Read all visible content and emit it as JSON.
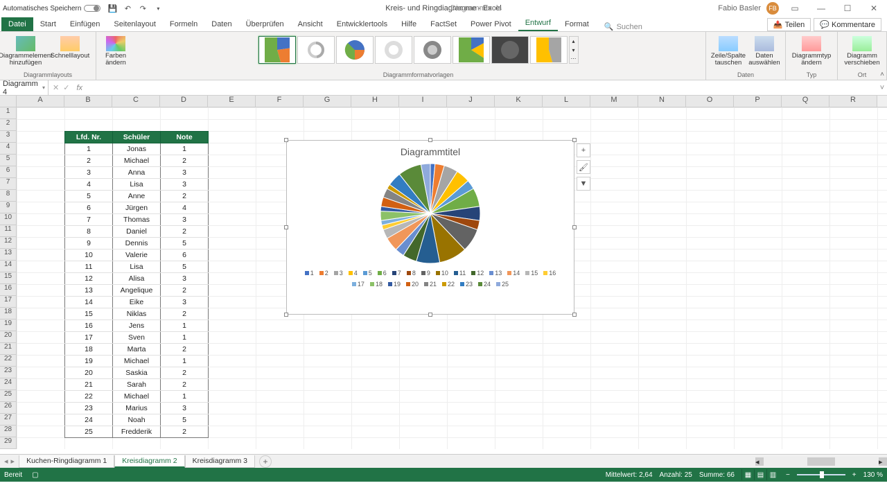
{
  "title_bar": {
    "autosave_label": "Automatisches Speichern",
    "doc_title": "Kreis- und Ringdiagramme  -  Excel",
    "tools_context": "Diagrammtools",
    "user_name": "Fabio Basler",
    "user_initials": "FB"
  },
  "tabs": {
    "file": "Datei",
    "list": [
      "Start",
      "Einfügen",
      "Seitenlayout",
      "Formeln",
      "Daten",
      "Überprüfen",
      "Ansicht",
      "Entwicklertools",
      "Hilfe",
      "FactSet",
      "Power Pivot"
    ],
    "ctx_entwurf": "Entwurf",
    "ctx_format": "Format",
    "tell_me": "Suchen",
    "share": "Teilen",
    "comments": "Kommentare"
  },
  "ribbon": {
    "add_element": "Diagrammelement hinzufügen",
    "quick_layout": "Schnelllayout",
    "change_colors": "Farben ändern",
    "group_layouts": "Diagrammlayouts",
    "group_styles": "Diagrammformatvorlagen",
    "switch_rc": "Zeile/Spalte tauschen",
    "select_data": "Daten auswählen",
    "group_data": "Daten",
    "change_type": "Diagrammtyp ändern",
    "group_type": "Typ",
    "move_chart": "Diagramm verschieben",
    "group_loc": "Ort"
  },
  "namebox": {
    "value": "Diagramm 4"
  },
  "columns": [
    "A",
    "B",
    "C",
    "D",
    "E",
    "F",
    "G",
    "H",
    "I",
    "J",
    "K",
    "L",
    "M",
    "N",
    "O",
    "P",
    "Q",
    "R"
  ],
  "row_count": 29,
  "headers": {
    "b": "Lfd. Nr.",
    "c": "Schüler",
    "d": "Note"
  },
  "rows": [
    {
      "n": 1,
      "s": "Jonas",
      "g": 1
    },
    {
      "n": 2,
      "s": "Michael",
      "g": 2
    },
    {
      "n": 3,
      "s": "Anna",
      "g": 3
    },
    {
      "n": 4,
      "s": "Lisa",
      "g": 3
    },
    {
      "n": 5,
      "s": "Anne",
      "g": 2
    },
    {
      "n": 6,
      "s": "Jürgen",
      "g": 4
    },
    {
      "n": 7,
      "s": "Thomas",
      "g": 3
    },
    {
      "n": 8,
      "s": "Daniel",
      "g": 2
    },
    {
      "n": 9,
      "s": "Dennis",
      "g": 5
    },
    {
      "n": 10,
      "s": "Valerie",
      "g": 6
    },
    {
      "n": 11,
      "s": "Lisa",
      "g": 5
    },
    {
      "n": 12,
      "s": "Alisa",
      "g": 3
    },
    {
      "n": 13,
      "s": "Angelique",
      "g": 2
    },
    {
      "n": 14,
      "s": "Eike",
      "g": 3
    },
    {
      "n": 15,
      "s": "Niklas",
      "g": 2
    },
    {
      "n": 16,
      "s": "Jens",
      "g": 1
    },
    {
      "n": 17,
      "s": "Sven",
      "g": 1
    },
    {
      "n": 18,
      "s": "Marta",
      "g": 2
    },
    {
      "n": 19,
      "s": "Michael",
      "g": 1
    },
    {
      "n": 20,
      "s": "Saskia",
      "g": 2
    },
    {
      "n": 21,
      "s": "Sarah",
      "g": 2
    },
    {
      "n": 22,
      "s": "Michael",
      "g": 1
    },
    {
      "n": 23,
      "s": "Marius",
      "g": 3
    },
    {
      "n": 24,
      "s": "Noah",
      "g": 5
    },
    {
      "n": 25,
      "s": "Fredderik",
      "g": 2
    }
  ],
  "chart": {
    "title": "Diagrammtitel",
    "legend": [
      "1",
      "2",
      "3",
      "4",
      "5",
      "6",
      "7",
      "8",
      "9",
      "10",
      "11",
      "12",
      "13",
      "14",
      "15",
      "16",
      "17",
      "18",
      "19",
      "20",
      "21",
      "22",
      "23",
      "24",
      "25"
    ],
    "colors": [
      "#4472c4",
      "#ed7d31",
      "#a5a5a5",
      "#ffc000",
      "#5b9bd5",
      "#70ad47",
      "#264478",
      "#9e480e",
      "#636363",
      "#997300",
      "#255e91",
      "#43682b",
      "#698ed0",
      "#f1975a",
      "#b7b7b7",
      "#ffcd33",
      "#7cafdd",
      "#8cc168",
      "#335aa1",
      "#d26012",
      "#848484",
      "#cc9a00",
      "#327dc2",
      "#5a8a39",
      "#8faadc"
    ]
  },
  "chart_data": {
    "type": "pie",
    "title": "Diagrammtitel",
    "categories": [
      "1",
      "2",
      "3",
      "4",
      "5",
      "6",
      "7",
      "8",
      "9",
      "10",
      "11",
      "12",
      "13",
      "14",
      "15",
      "16",
      "17",
      "18",
      "19",
      "20",
      "21",
      "22",
      "23",
      "24",
      "25"
    ],
    "values": [
      1,
      2,
      3,
      3,
      2,
      4,
      3,
      2,
      5,
      6,
      5,
      3,
      2,
      3,
      2,
      1,
      1,
      2,
      1,
      2,
      2,
      1,
      3,
      5,
      2
    ],
    "series_name": "Note"
  },
  "sheets": {
    "list": [
      "Kuchen-Ringdiagramm 1",
      "Kreisdiagramm 2",
      "Kreisdiagramm 3"
    ],
    "active_index": 1
  },
  "status": {
    "ready": "Bereit",
    "avg_label": "Mittelwert:",
    "avg": "2,64",
    "count_label": "Anzahl:",
    "count": "25",
    "sum_label": "Summe:",
    "sum": "66",
    "zoom": "130 %"
  }
}
